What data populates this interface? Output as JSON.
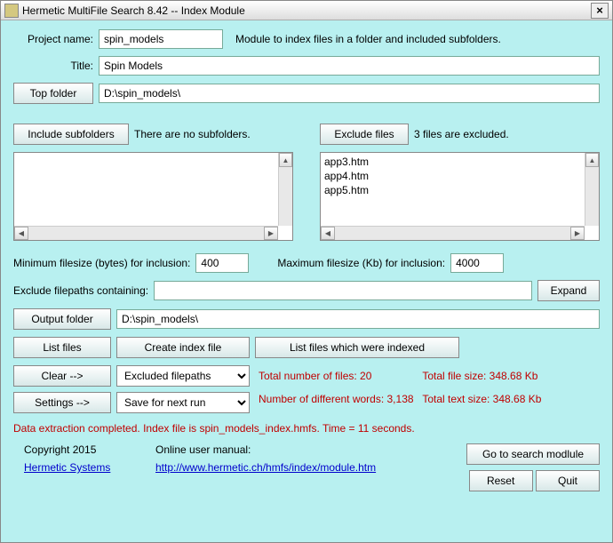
{
  "window": {
    "title": "Hermetic MultiFile Search 8.42 -- Index Module",
    "close": "×"
  },
  "form": {
    "project_label": "Project name:",
    "project_value": "spin_models",
    "module_desc": "Module to index files in a folder and included subfolders.",
    "title_label": "Title:",
    "title_value": "Spin Models",
    "top_folder_btn": "Top folder",
    "top_folder_value": "D:\\spin_models\\",
    "include_subfolders_btn": "Include subfolders",
    "no_subfolders_text": "There are no subfolders.",
    "exclude_files_btn": "Exclude files",
    "excluded_count_text": "3 files are excluded.",
    "excluded_files": [
      "app3.htm",
      "app4.htm",
      "app5.htm"
    ],
    "min_filesize_label": "Minimum filesize (bytes) for inclusion:",
    "min_filesize_value": "400",
    "max_filesize_label": "Maximum filesize (Kb) for inclusion:",
    "max_filesize_value": "4000",
    "exclude_paths_label": "Exclude filepaths containing:",
    "exclude_paths_value": "",
    "expand_btn": "Expand",
    "output_folder_btn": "Output folder",
    "output_folder_value": "D:\\spin_models\\",
    "list_files_btn": "List files",
    "create_index_btn": "Create index file",
    "list_indexed_btn": "List files which were indexed",
    "clear_btn": "Clear -->",
    "clear_combo": "Excluded filepaths",
    "settings_btn": "Settings -->",
    "settings_combo": "Save for next run"
  },
  "stats": {
    "total_files": "Total number of files: 20",
    "total_file_size": "Total file size: 348.68 Kb",
    "diff_words": "Number of different words: 3,138",
    "total_text_size": "Total text size: 348.68 Kb"
  },
  "status": "Data extraction completed.   Index file is spin_models_index.hmfs.   Time = 11 seconds.",
  "footer": {
    "copyright": "Copyright 2015",
    "company": "Hermetic Systems",
    "manual_label": "Online user manual:",
    "manual_url": "http://www.hermetic.ch/hmfs/index/module.htm",
    "goto_search_btn": "Go to search modlule",
    "reset_btn": "Reset",
    "quit_btn": "Quit"
  }
}
